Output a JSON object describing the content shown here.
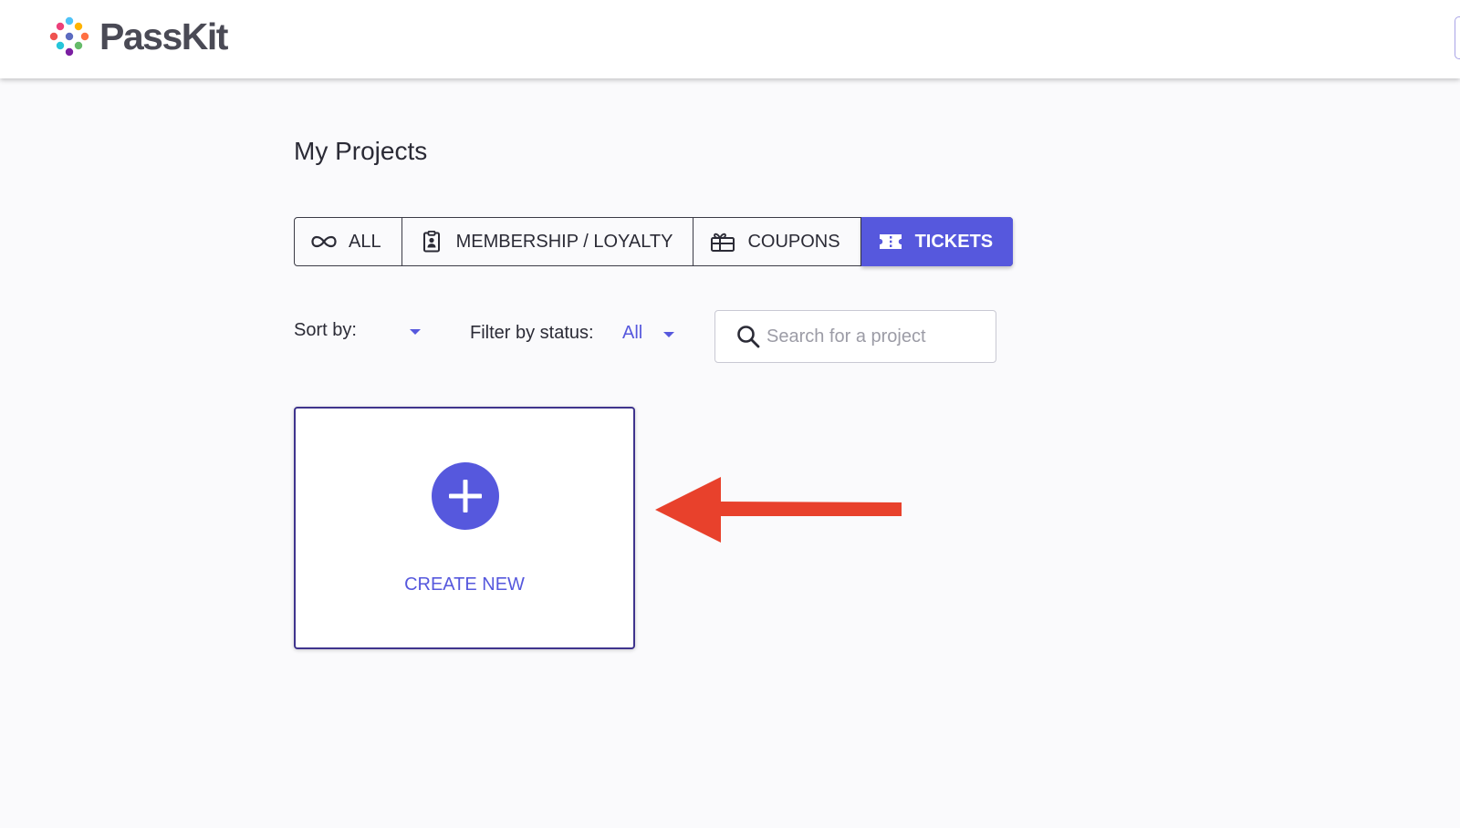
{
  "header": {
    "brand": "PassKit"
  },
  "page": {
    "title": "My Projects"
  },
  "tabs": [
    {
      "label": "ALL",
      "icon": "infinity-icon"
    },
    {
      "label": "MEMBERSHIP / LOYALTY",
      "icon": "id-badge-icon"
    },
    {
      "label": "COUPONS",
      "icon": "gift-icon"
    },
    {
      "label": "TICKETS",
      "icon": "ticket-icon",
      "active": true
    }
  ],
  "controls": {
    "sort_label": "Sort by:",
    "filter_label": "Filter by status:",
    "filter_value": "All",
    "search_placeholder": "Search for a project"
  },
  "create_card": {
    "label": "CREATE NEW",
    "icon": "plus-circle-icon"
  },
  "annotation": {
    "icon": "red-arrow-left-icon",
    "color": "#e8412c"
  },
  "colors": {
    "accent": "#5658dd",
    "card_border": "#3f348d"
  }
}
